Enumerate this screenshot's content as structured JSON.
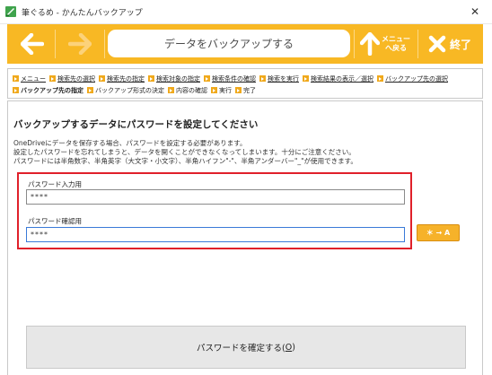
{
  "window": {
    "title": "筆ぐるめ - かんたんバックアップ",
    "close_glyph": "✕"
  },
  "toolbar": {
    "page_title": "データをバックアップする",
    "menu_label_line1": "メニュー",
    "menu_label_line2": "へ戻る",
    "exit_label": "終了",
    "accent_color": "#f8b824"
  },
  "breadcrumb": {
    "row1": [
      {
        "label": "メニュー",
        "style": "link"
      },
      {
        "label": "検索先の選択",
        "style": "link"
      },
      {
        "label": "検索先の指定",
        "style": "link"
      },
      {
        "label": "検索対象の指定",
        "style": "link"
      },
      {
        "label": "検索条件の確認",
        "style": "link"
      },
      {
        "label": "検索を実行",
        "style": "link"
      },
      {
        "label": "検索結果の表示／選択",
        "style": "link"
      },
      {
        "label": "バックアップ先の選択",
        "style": "link"
      }
    ],
    "row2": [
      {
        "label": "バックアップ先の指定",
        "style": "current"
      },
      {
        "label": "バックアップ形式の決定",
        "style": "plain"
      },
      {
        "label": "内容の確認",
        "style": "plain"
      },
      {
        "label": "実行",
        "style": "plain"
      },
      {
        "label": "完了",
        "style": "plain"
      }
    ]
  },
  "main": {
    "heading": "バックアップするデータにパスワードを設定してください",
    "desc_line1": "OneDriveにデータを保存する場合、パスワードを設定する必要があります。",
    "desc_line2": "設定したパスワードを忘れてしまうと、データを開くことができなくなってしまいます。十分にご注意ください。",
    "desc_line3": "パスワードには半角数字、半角英字（大文字・小文字）、半角ハイフン\"-\"、半角アンダーバー\"_\"が使用できます。",
    "password_label": "パスワード入力用",
    "password_value": "****",
    "confirm_label": "パスワード確認用",
    "confirm_value": "****",
    "convert_button": "＊ → A",
    "confirm_button_text": "パスワードを確定する(",
    "confirm_button_mnemonic": "O",
    "confirm_button_close": ")",
    "highlight_color": "#e0202a"
  }
}
